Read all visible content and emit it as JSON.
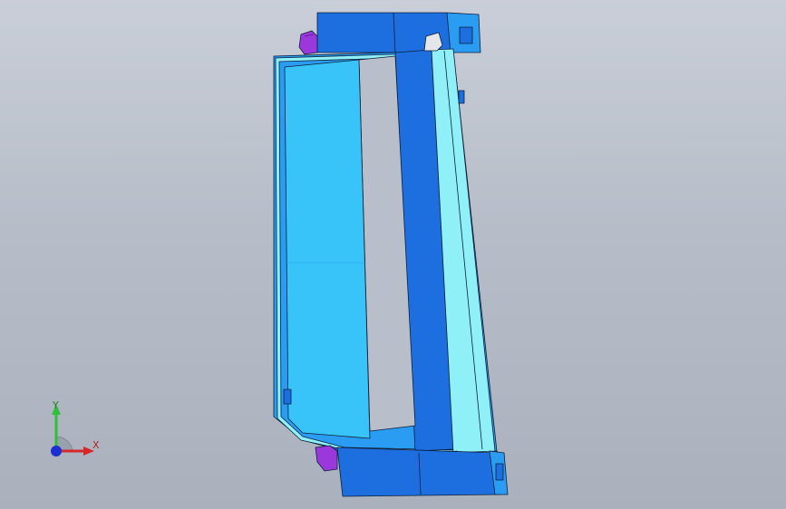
{
  "viewport": {
    "background_top": "#c9ced8",
    "background_bottom": "#aab1bd"
  },
  "colors": {
    "part_dark_blue": "#1d6fe0",
    "part_mid_blue": "#2a9cf2",
    "part_light_cyan": "#38c4f8",
    "part_pale_cyan": "#8ff0f8",
    "fastener_purple": "#9a38dc",
    "clip_white": "#e4e6ea",
    "edge_line": "#0c1f3a"
  },
  "triad": {
    "y_label": "Y",
    "x_label": "X",
    "y_axis_color": "#2fbf3a",
    "x_axis_color": "#d8272b",
    "z_axis_color": "#1c2fd0"
  },
  "model": {
    "icon": "3d-part-model"
  }
}
